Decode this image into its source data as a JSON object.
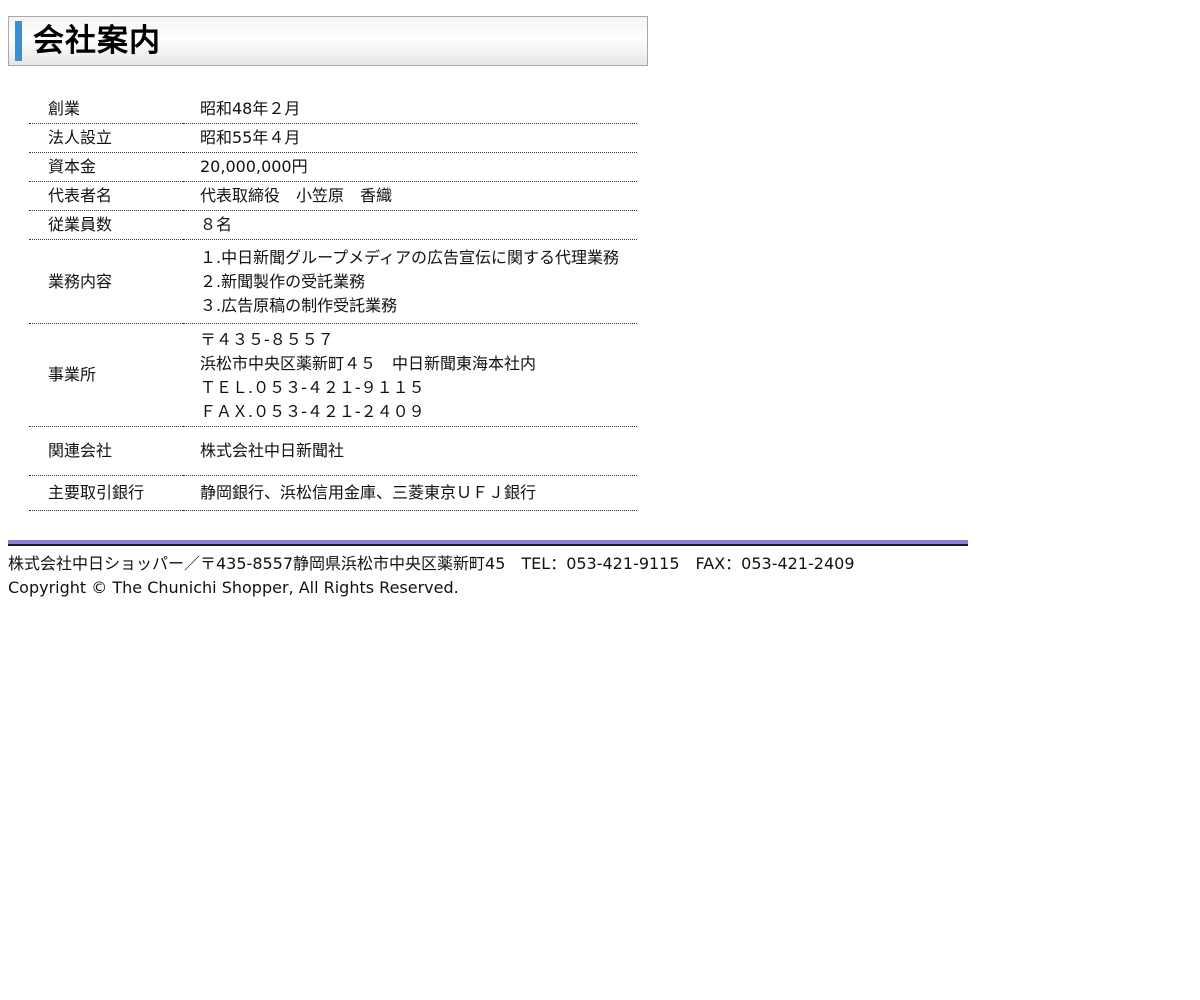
{
  "header": {
    "title": "会社案内"
  },
  "company_info": {
    "rows": [
      {
        "label": "創業",
        "lines": [
          "昭和48年２月"
        ]
      },
      {
        "label": "法人設立",
        "lines": [
          "昭和55年４月"
        ]
      },
      {
        "label": "資本金",
        "lines": [
          "20,000,000円"
        ]
      },
      {
        "label": "代表者名",
        "lines": [
          "代表取締役　小笠原　香織"
        ]
      },
      {
        "label": "従業員数",
        "lines": [
          "８名"
        ]
      },
      {
        "label": "業務内容",
        "lines": [
          "１.中日新聞グループメディアの広告宣伝に関する代理業務",
          "２.新聞製作の受託業務",
          "３.広告原稿の制作受託業務"
        ]
      },
      {
        "label": "事業所",
        "lines": [
          "〒４３５-８５５７",
          "浜松市中央区薬新町４５　中日新聞東海本社内",
          "ＴＥＬ.０５３-４２１-９１１５",
          "ＦＡＸ.０５３-４２１-２４０９"
        ]
      },
      {
        "label": "関連会社",
        "lines": [
          "株式会社中日新聞社"
        ]
      },
      {
        "label": "主要取引銀行",
        "lines": [
          "静岡銀行、浜松信用金庫、三菱東京ＵＦＪ銀行"
        ]
      }
    ]
  },
  "footer": {
    "address": "株式会社中日ショッパー／〒435-8557静岡県浜松市中央区薬新町45　TEL：053-421-9115　FAX：053-421-2409",
    "copyright": "Copyright © The Chunichi Shopper, All Rights Reserved."
  },
  "colors": {
    "title_accent": "#3b8fd0",
    "footer_rule": "#8a7fd6"
  }
}
